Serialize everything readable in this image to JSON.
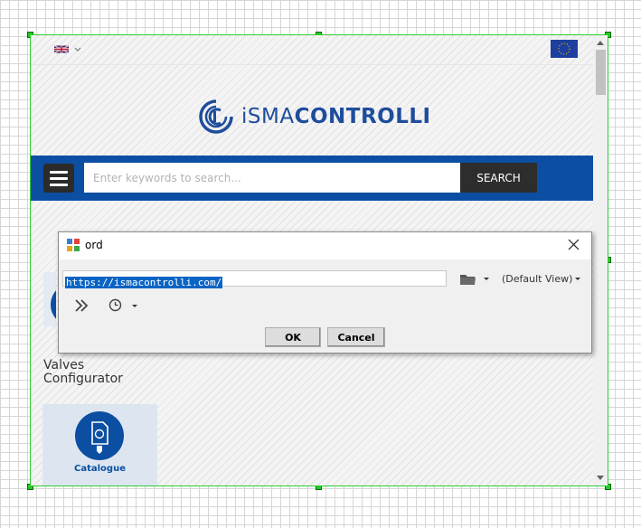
{
  "page": {
    "language_flag_icon": "uk-flag-icon",
    "region_flag_icon": "eu-flag-icon",
    "logo": {
      "prefix": "iSMA",
      "suffix": "CONTROLLI"
    },
    "search": {
      "menu_icon": "hamburger-menu-icon",
      "placeholder": "Enter keywords to search...",
      "button_label": "SEARCH"
    },
    "tiles": {
      "valves_label_line1": "Valves",
      "valves_label_line2": "Configurator",
      "catalogue_label": "Catalogue"
    }
  },
  "dialog": {
    "title": "ord",
    "url_value": "https://ismacontrolli.com/",
    "view_label": "(Default View)",
    "ok_label": "OK",
    "cancel_label": "Cancel"
  },
  "colors": {
    "brand_blue": "#0c4ea2",
    "selection_frame": "#2ecc2e",
    "search_button": "#2d2d2d"
  }
}
